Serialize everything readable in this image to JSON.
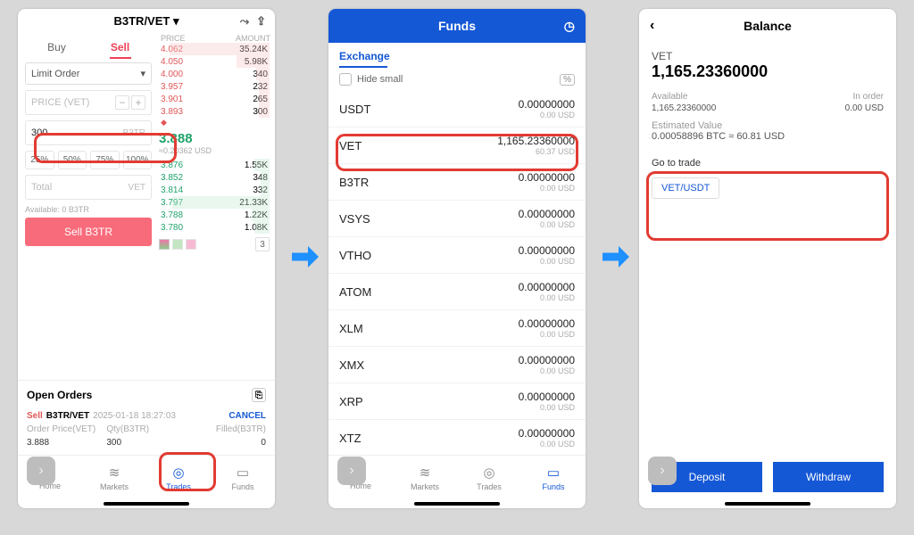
{
  "phone1": {
    "pair": "B3TR/VET",
    "tabs": {
      "buy": "Buy",
      "sell": "Sell"
    },
    "order_type": "Limit Order",
    "price_placeholder": "PRICE (VET)",
    "amount_value": "300",
    "amount_suffix": "B3TR",
    "pct": [
      "25%",
      "50%",
      "75%",
      "100%"
    ],
    "total_placeholder": "Total",
    "total_suffix": "VET",
    "available": "Available: 0 B3TR",
    "sell_button": "Sell B3TR",
    "ob_head": {
      "price": "PRICE",
      "amount": "AMOUNT"
    },
    "asks": [
      [
        "4.062",
        "35.24K",
        90
      ],
      [
        "4.050",
        "5.98K",
        30
      ],
      [
        "4.000",
        "340",
        12
      ],
      [
        "3.957",
        "232",
        10
      ],
      [
        "3.901",
        "265",
        10
      ],
      [
        "3.893",
        "300",
        10
      ]
    ],
    "mid": {
      "price": "3.888",
      "usd": "≈0.20362 USD"
    },
    "bids": [
      [
        "3.876",
        "1.55K",
        14
      ],
      [
        "3.852",
        "348",
        8
      ],
      [
        "3.814",
        "332",
        8
      ],
      [
        "3.797",
        "21.33K",
        88
      ],
      [
        "3.788",
        "1.22K",
        16
      ],
      [
        "3.780",
        "1.08K",
        14
      ]
    ],
    "decimals_value": "3",
    "open_orders_title": "Open Orders",
    "order": {
      "side": "Sell",
      "pair": "B3TR/VET",
      "time": "2025-01-18 18:27:03",
      "cancel": "CANCEL",
      "labels": [
        "Order Price(VET)",
        "Qty(B3TR)",
        "Filled(B3TR)"
      ],
      "values": [
        "3.888",
        "300",
        "0"
      ]
    }
  },
  "phone2": {
    "title": "Funds",
    "subtab": "Exchange",
    "hide_small": "Hide small",
    "assets": [
      {
        "sym": "USDT",
        "bal": "0.00000000",
        "usd": "0.00 USD"
      },
      {
        "sym": "VET",
        "bal": "1,165.23360000",
        "usd": "60.37 USD"
      },
      {
        "sym": "B3TR",
        "bal": "0.00000000",
        "usd": "0.00 USD"
      },
      {
        "sym": "VSYS",
        "bal": "0.00000000",
        "usd": "0.00 USD"
      },
      {
        "sym": "VTHO",
        "bal": "0.00000000",
        "usd": "0.00 USD"
      },
      {
        "sym": "ATOM",
        "bal": "0.00000000",
        "usd": "0.00 USD"
      },
      {
        "sym": "XLM",
        "bal": "0.00000000",
        "usd": "0.00 USD"
      },
      {
        "sym": "XMX",
        "bal": "0.00000000",
        "usd": "0.00 USD"
      },
      {
        "sym": "XRP",
        "bal": "0.00000000",
        "usd": "0.00 USD"
      },
      {
        "sym": "XTZ",
        "bal": "0.00000000",
        "usd": "0.00 USD"
      }
    ]
  },
  "phone3": {
    "title": "Balance",
    "symbol": "VET",
    "balance": "1,165.23360000",
    "available_label": "Available",
    "available_value": "1,165.23360000",
    "inorder_label": "In order",
    "inorder_value": "0.00 USD",
    "est_label": "Estimated Value",
    "est_value": "0.00058896 BTC ≈ 60.81 USD",
    "goto_label": "Go to trade",
    "goto_pair": "VET/USDT",
    "actions": {
      "deposit": "Deposit",
      "withdraw": "Withdraw"
    }
  },
  "nav": {
    "home": "Home",
    "markets": "Markets",
    "trades": "Trades",
    "funds": "Funds"
  }
}
